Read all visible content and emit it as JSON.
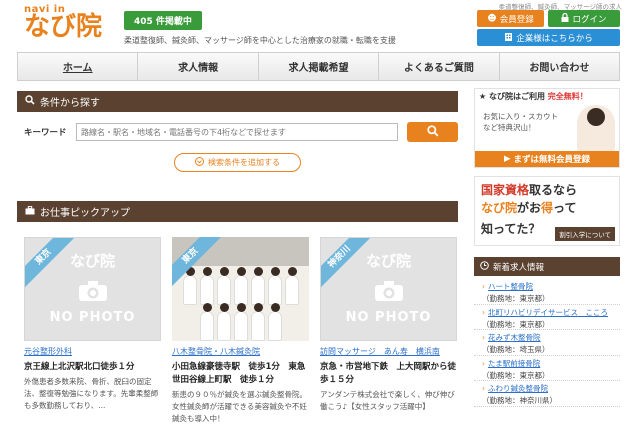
{
  "header": {
    "logo_top": "navi in",
    "logo_main": "なび院",
    "count_badge": "405 件掲載中",
    "tagline": "柔道整復師、鍼灸師、マッサージ師を中心とした治療家の就職・転職を支援",
    "tiny_text": "柔道整復師、鍼灸師、マッサージ師の求人",
    "register_label": "会員登録",
    "login_label": "ログイン",
    "company_label": "企業様はこちらから"
  },
  "nav": {
    "items": [
      {
        "label": "ホーム"
      },
      {
        "label": "求人情報"
      },
      {
        "label": "求人掲載希望"
      },
      {
        "label": "よくあるご質問"
      },
      {
        "label": "お問い合わせ"
      }
    ]
  },
  "search": {
    "title": "条件から探す",
    "keyword_label": "キーワード",
    "placeholder": "路線名・駅名・地域名・電話番号の下4桁などで探せます",
    "add_condition_label": "検索条件を追加する"
  },
  "pickup": {
    "title": "お仕事ピックアップ",
    "no_photo_logo": "なび院",
    "no_photo_text": "NO PHOTO",
    "cards": [
      {
        "region": "東京",
        "title": "元谷整形外科",
        "access": "京王線上北沢駅北口徒歩１分",
        "description": "外傷患者多数来院、骨折、脱臼の固定法、整復等勉強になります。先輩柔整師も多数勤務しており、..."
      },
      {
        "region": "東京",
        "title": "八木整骨院・八木鍼灸院",
        "access": "小田急線豪徳寺駅　徒歩1分　東急世田谷線上町駅　徒歩１分",
        "description": "新患の９０％が鍼灸を選ぶ鍼灸整骨院。女性鍼灸師が活躍できる美容鍼灸や不妊鍼灸も導入中！"
      },
      {
        "region": "神奈川",
        "title": "訪問マッサージ　あん寿　横浜南",
        "access": "京急・市営地下鉄　上大岡駅から徒歩１５分",
        "description": "アンダンテ株式会社で楽しく、伸び伸び働こう♪【女性スタッフ活躍中】"
      }
    ]
  },
  "banner1": {
    "title_prefix": "なび院はご利用",
    "title_emph": "完全無料！",
    "middle_line1": "お気に入り・スカウト",
    "middle_line2": "など特典沢山！",
    "bottom": "まずは無料会員登録"
  },
  "banner2": {
    "line1_red": "国家資格",
    "line1_rest": "取るなら",
    "line2_orange1": "なび院",
    "line2_mid": "がお",
    "line2_orange2": "得",
    "line2_end": "って",
    "line3": "知ってた？",
    "badge": "割引入学について"
  },
  "news": {
    "title": "新着求人情報",
    "items": [
      {
        "title": "ハート整骨院",
        "area": "（勤務地：東京都）"
      },
      {
        "title": "北町リハビリデイサービス　こころ",
        "area": "（勤務地：東京都）"
      },
      {
        "title": "花みず木整骨院",
        "area": "（勤務地：埼玉県）"
      },
      {
        "title": "たま駅前接骨院",
        "area": "（勤務地：東京都）"
      },
      {
        "title": "ふわり鍼灸整骨院",
        "area": "（勤務地：神奈川県）"
      }
    ]
  }
}
